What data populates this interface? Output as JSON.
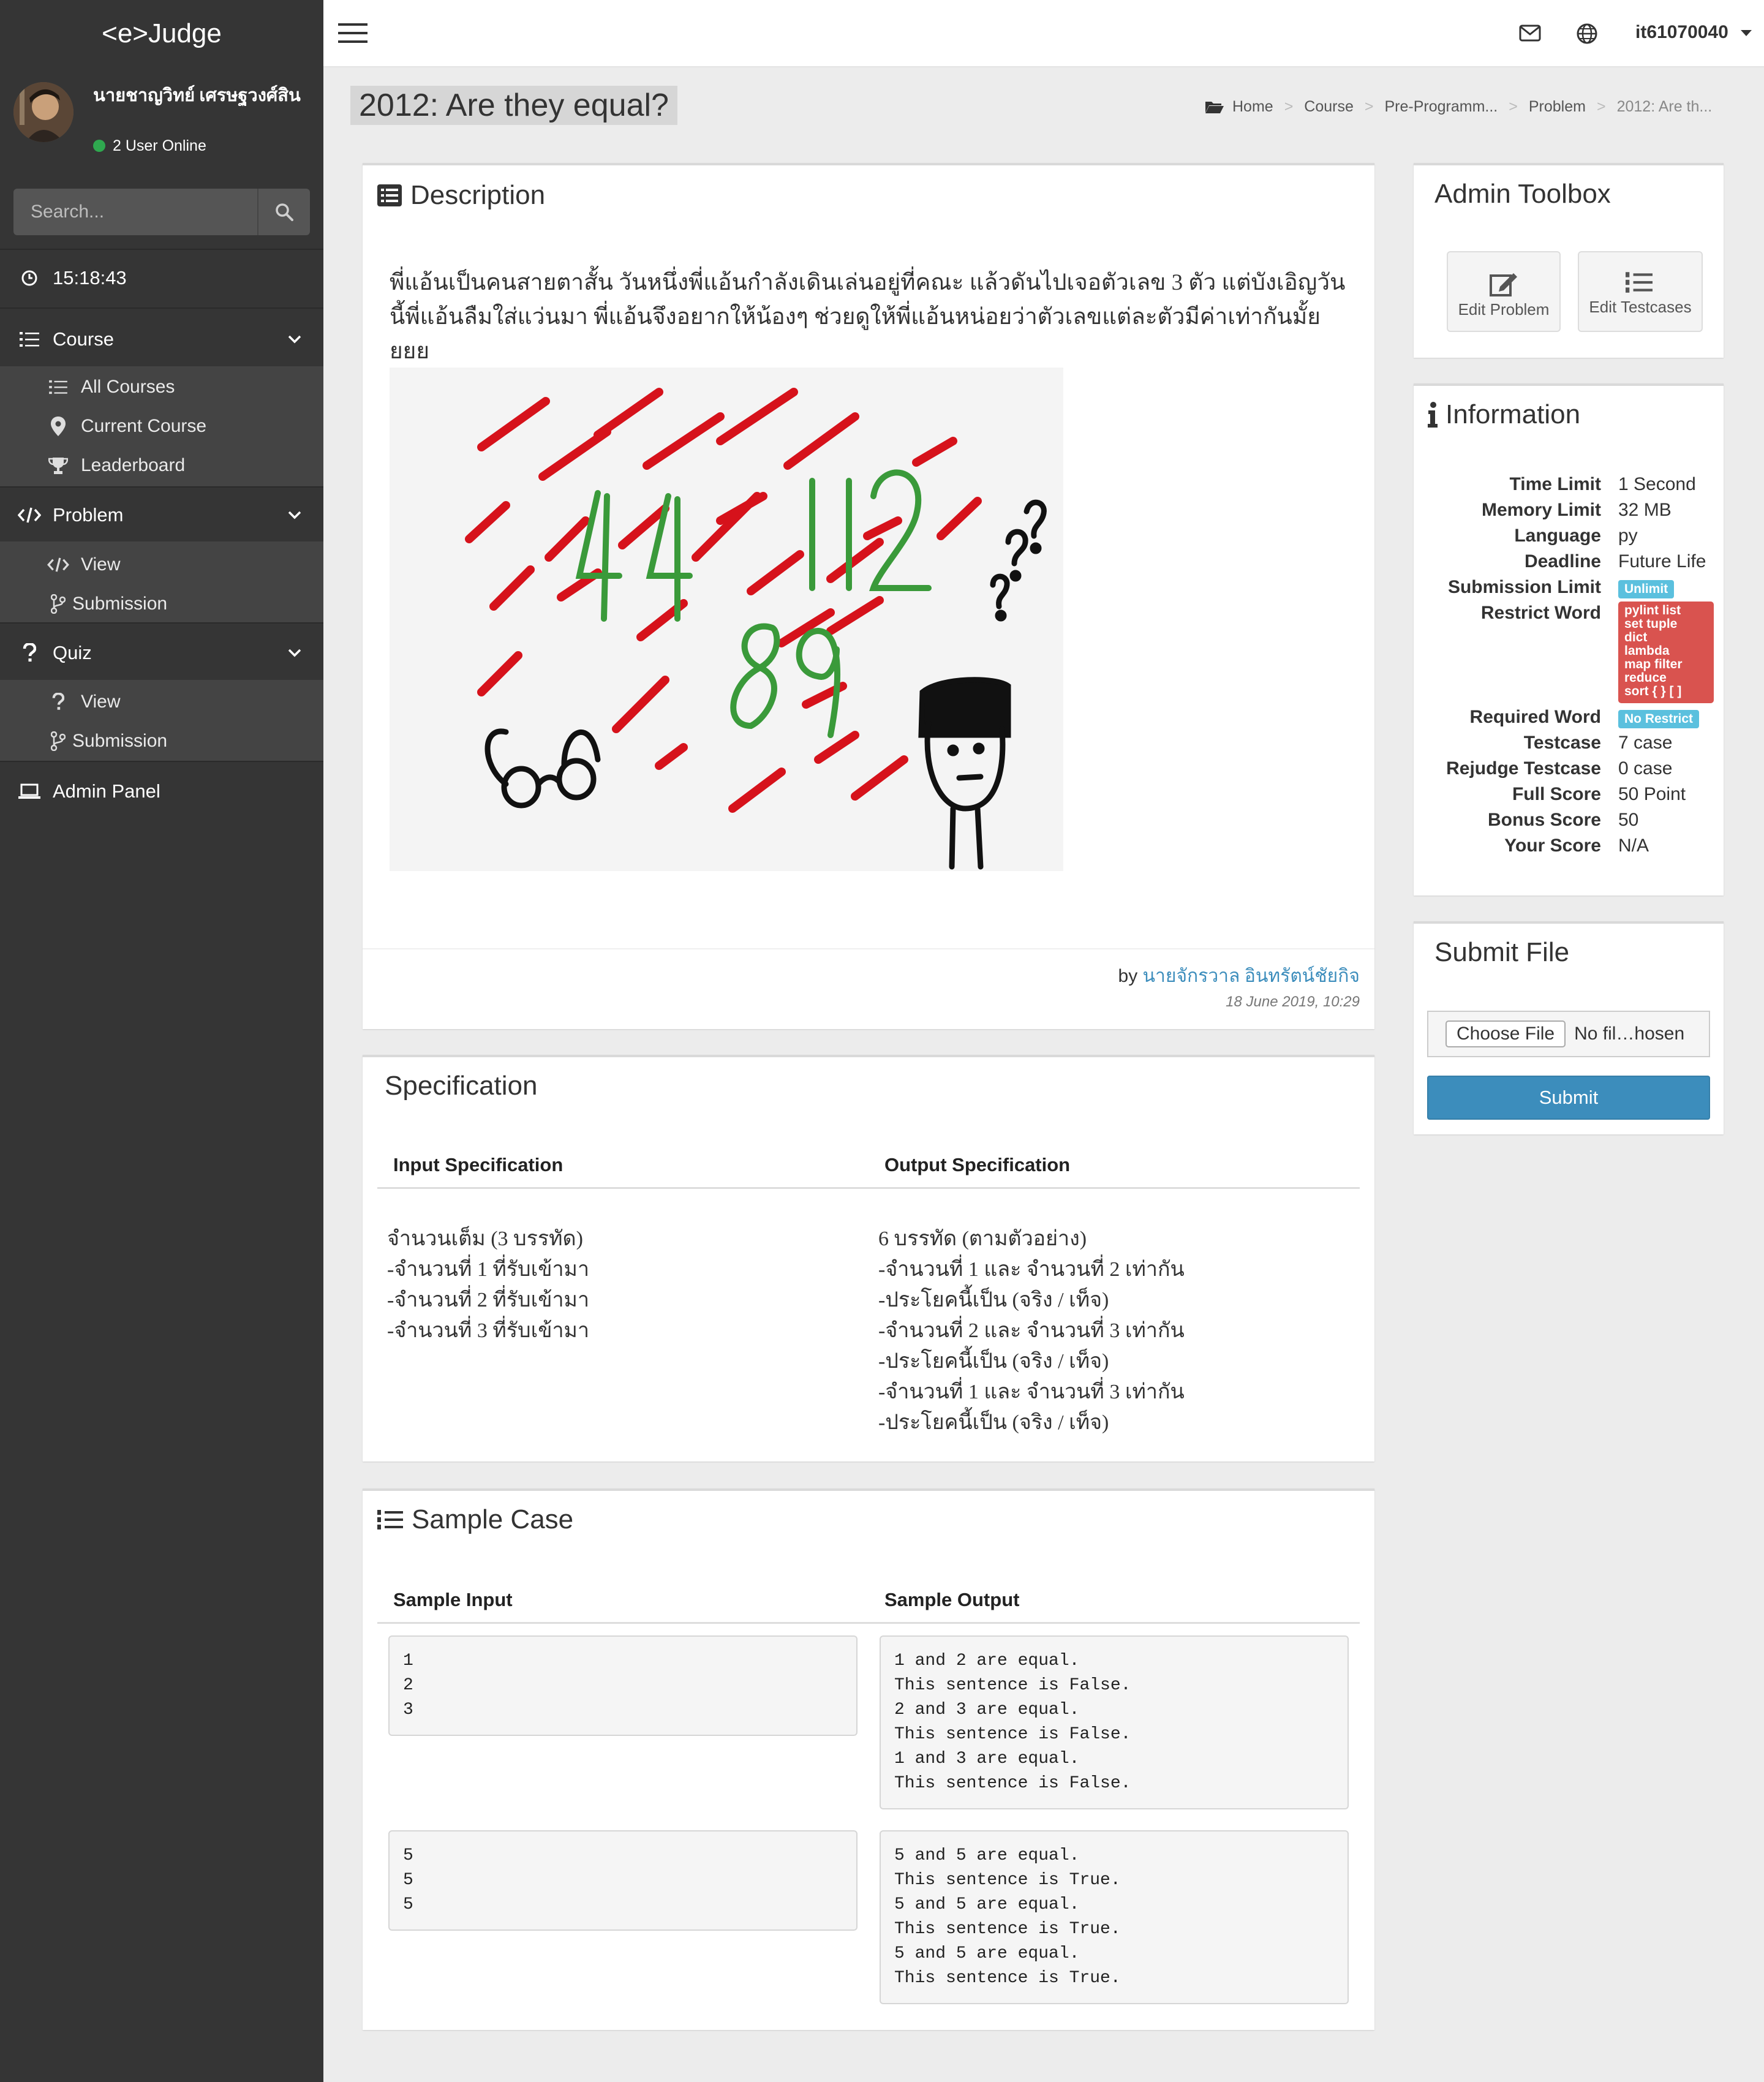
{
  "app": {
    "brand": "<e>Judge",
    "clock": "15:18:43"
  },
  "user": {
    "name": "นายชาญวิทย์ เศรษฐวงศ์สิน",
    "online_text": "2 User Online",
    "account": "it61070040"
  },
  "search": {
    "placeholder": "Search..."
  },
  "sidebar": {
    "course": {
      "label": "Course",
      "items": [
        {
          "label": "All Courses"
        },
        {
          "label": "Current Course"
        },
        {
          "label": "Leaderboard"
        }
      ]
    },
    "problem": {
      "label": "Problem",
      "items": [
        {
          "label": "View"
        },
        {
          "label": "Submission"
        }
      ]
    },
    "quiz": {
      "label": "Quiz",
      "items": [
        {
          "label": "View"
        },
        {
          "label": "Submission"
        }
      ]
    },
    "admin": {
      "label": "Admin Panel"
    }
  },
  "page": {
    "title": "2012: Are they equal?"
  },
  "breadcrumb": [
    "Home",
    "Course",
    "Pre-Programm...",
    "Problem",
    "2012: Are th..."
  ],
  "description": {
    "title": "Description",
    "text": "พี่แอ้นเป็นคนสายตาสั้น วันหนึ่งพี่แอ้นกำลังเดินเล่นอยู่ที่คณะ แล้วดันไปเจอตัวเลข 3 ตัว แต่บังเอิญวันนี้พี่แอ้นลืมใส่แว่นมา พี่แอ้นจึงอยากให้น้องๆ ช่วยดูให้พี่แอ้นหน่อยว่าตัวเลขแต่ละตัวมีค่าเท่ากันมั้ยยยย",
    "image_numbers": [
      "44",
      "112",
      "89"
    ],
    "by_prefix": "by",
    "author": "นายจักรวาล อินทรัตน์ชัยกิจ",
    "date": "18 June 2019, 10:29"
  },
  "specification": {
    "title": "Specification",
    "input_header": "Input Specification",
    "output_header": "Output Specification",
    "input_lines": [
      "จำนวนเต็ม (3 บรรทัด)",
      "-จำนวนที่ 1 ที่รับเข้ามา",
      "-จำนวนที่ 2 ที่รับเข้ามา",
      "-จำนวนที่ 3 ที่รับเข้ามา"
    ],
    "output_lines": [
      "6 บรรทัด (ตามตัวอย่าง)",
      "-จำนวนที่ 1 และ จำนวนที่ 2 เท่ากัน",
      "-ประโยคนี้เป็น (จริง / เท็จ)",
      "-จำนวนที่ 2 และ จำนวนที่ 3 เท่ากัน",
      "-ประโยคนี้เป็น (จริง / เท็จ)",
      "-จำนวนที่ 1 และ จำนวนที่ 3 เท่ากัน",
      "-ประโยคนี้เป็น (จริง / เท็จ)"
    ]
  },
  "samples": {
    "title": "Sample Case",
    "input_header": "Sample Input",
    "output_header": "Sample Output",
    "cases": [
      {
        "input": "1\n2\n3",
        "output": "1 and 2 are equal.\nThis sentence is False.\n2 and 3 are equal.\nThis sentence is False.\n1 and 3 are equal.\nThis sentence is False."
      },
      {
        "input": "5\n5\n5",
        "output": "5 and 5 are equal.\nThis sentence is True.\n5 and 5 are equal.\nThis sentence is True.\n5 and 5 are equal.\nThis sentence is True."
      }
    ]
  },
  "admin_toolbox": {
    "title": "Admin Toolbox",
    "edit_problem": "Edit Problem",
    "edit_testcases": "Edit Testcases"
  },
  "information": {
    "title": "Information",
    "time_limit": {
      "label": "Time Limit",
      "value": "1 Second"
    },
    "memory_limit": {
      "label": "Memory Limit",
      "value": "32 MB"
    },
    "language": {
      "label": "Language",
      "value": "py"
    },
    "deadline": {
      "label": "Deadline",
      "value": "Future Life"
    },
    "submission_limit": {
      "label": "Submission Limit",
      "value": "Unlimit"
    },
    "restrict_word": {
      "label": "Restrict Word",
      "values": [
        "pylint list",
        "set tuple",
        "dict",
        "lambda",
        "map filter",
        "reduce",
        "sort { } [ ]"
      ]
    },
    "required_word": {
      "label": "Required Word",
      "value": "No Restrict"
    },
    "testcase": {
      "label": "Testcase",
      "value": "7 case"
    },
    "rejudge_testcase": {
      "label": "Rejudge Testcase",
      "value": "0 case"
    },
    "full_score": {
      "label": "Full Score",
      "value": "50 Point"
    },
    "bonus_score": {
      "label": "Bonus Score",
      "value": "50"
    },
    "your_score": {
      "label": "Your Score",
      "value": "N/A"
    }
  },
  "submit_file": {
    "title": "Submit File",
    "choose_label": "Choose File",
    "file_name": "No fil…hosen",
    "submit_label": "Submit"
  },
  "colors": {
    "sidebar": "#353535",
    "accent_blue": "#3c8dbc",
    "badge_info": "#5bc0de",
    "badge_danger": "#d9534f",
    "link": "#3c8dbc",
    "online": "#2fa84f"
  }
}
